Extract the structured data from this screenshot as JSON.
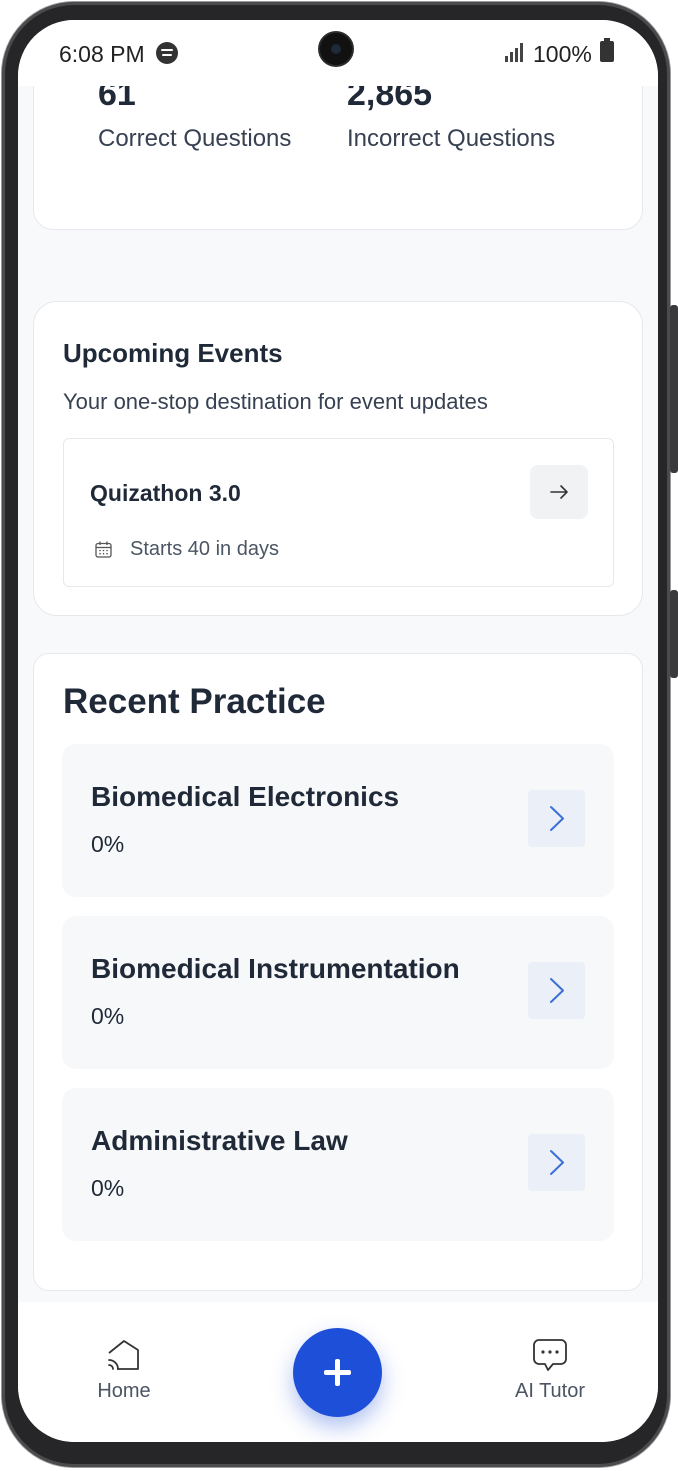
{
  "status_bar": {
    "time": "6:08 PM",
    "battery": "100%",
    "icons": [
      "spotify-icon",
      "signal-icon",
      "battery-icon"
    ]
  },
  "stats": {
    "correct_value": "61",
    "correct_label": "Correct Questions",
    "incorrect_value": "2,865",
    "incorrect_label": "Incorrect Questions"
  },
  "events": {
    "title": "Upcoming Events",
    "subtitle": "Your one-stop destination for event updates",
    "items": [
      {
        "name": "Quizathon 3.0",
        "date_text": "Starts 40 in days"
      }
    ]
  },
  "practice": {
    "title": "Recent Practice",
    "items": [
      {
        "name": "Biomedical Electronics",
        "progress": "0%"
      },
      {
        "name": "Biomedical Instrumentation",
        "progress": "0%"
      },
      {
        "name": "Administrative Law",
        "progress": "0%"
      }
    ]
  },
  "nav": {
    "home_label": "Home",
    "tutor_label": "AI Tutor"
  },
  "colors": {
    "accent": "#1e4fd8",
    "chevron": "#3b6fd8"
  }
}
